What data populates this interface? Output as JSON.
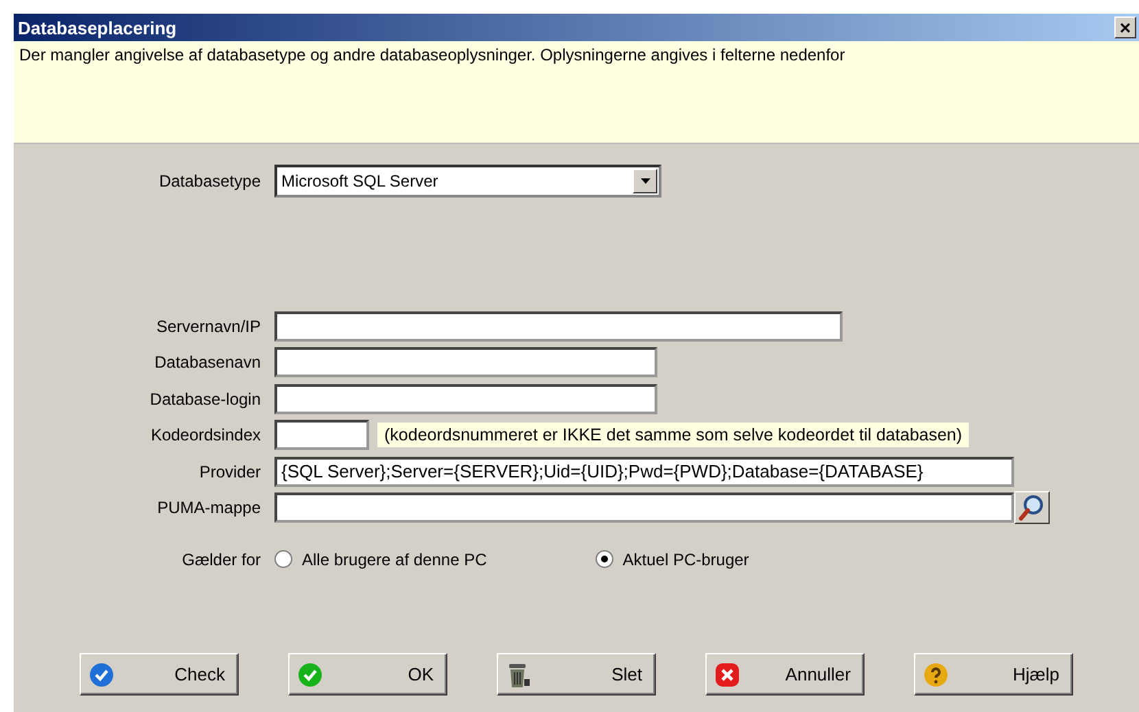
{
  "window": {
    "title": "Databaseplacering",
    "close": "×"
  },
  "info": "Der mangler angivelse af databasetype og andre databaseoplysninger. Oplysningerne angives i felterne nedenfor",
  "database_type": {
    "label": "Databasetype",
    "value": "Microsoft SQL Server"
  },
  "fields": [
    {
      "label": "Servernavn/IP",
      "kind": "wide"
    },
    {
      "label": "Databasenavn",
      "kind": "medium"
    },
    {
      "label": "Database-login",
      "kind": "medium"
    },
    {
      "label": "Kodeordsindex",
      "kind": "short",
      "note": "(kodeordsnummeret er IKKE det samme som selve kodeordet til databasen)"
    },
    {
      "label": "Provider",
      "value": "{SQL Server};Server={SERVER};Uid={UID};Pwd={PWD};Database={DATABASE}",
      "kind": "full"
    },
    {
      "label": "PUMA-mappe",
      "kind": "browse"
    }
  ],
  "applies_to": {
    "label": "Gælder for",
    "options": [
      {
        "label": "Alle brugere af denne PC",
        "selected": false
      },
      {
        "label": "Aktuel PC-bruger",
        "selected": true
      }
    ]
  },
  "buttons": [
    {
      "label": "Check",
      "kind": "check"
    },
    {
      "label": "OK",
      "kind": "ok"
    },
    {
      "label": "Slet",
      "kind": "delete"
    },
    {
      "label": "Annuller",
      "kind": "cancel"
    },
    {
      "label": "Hjælp",
      "kind": "help"
    }
  ]
}
